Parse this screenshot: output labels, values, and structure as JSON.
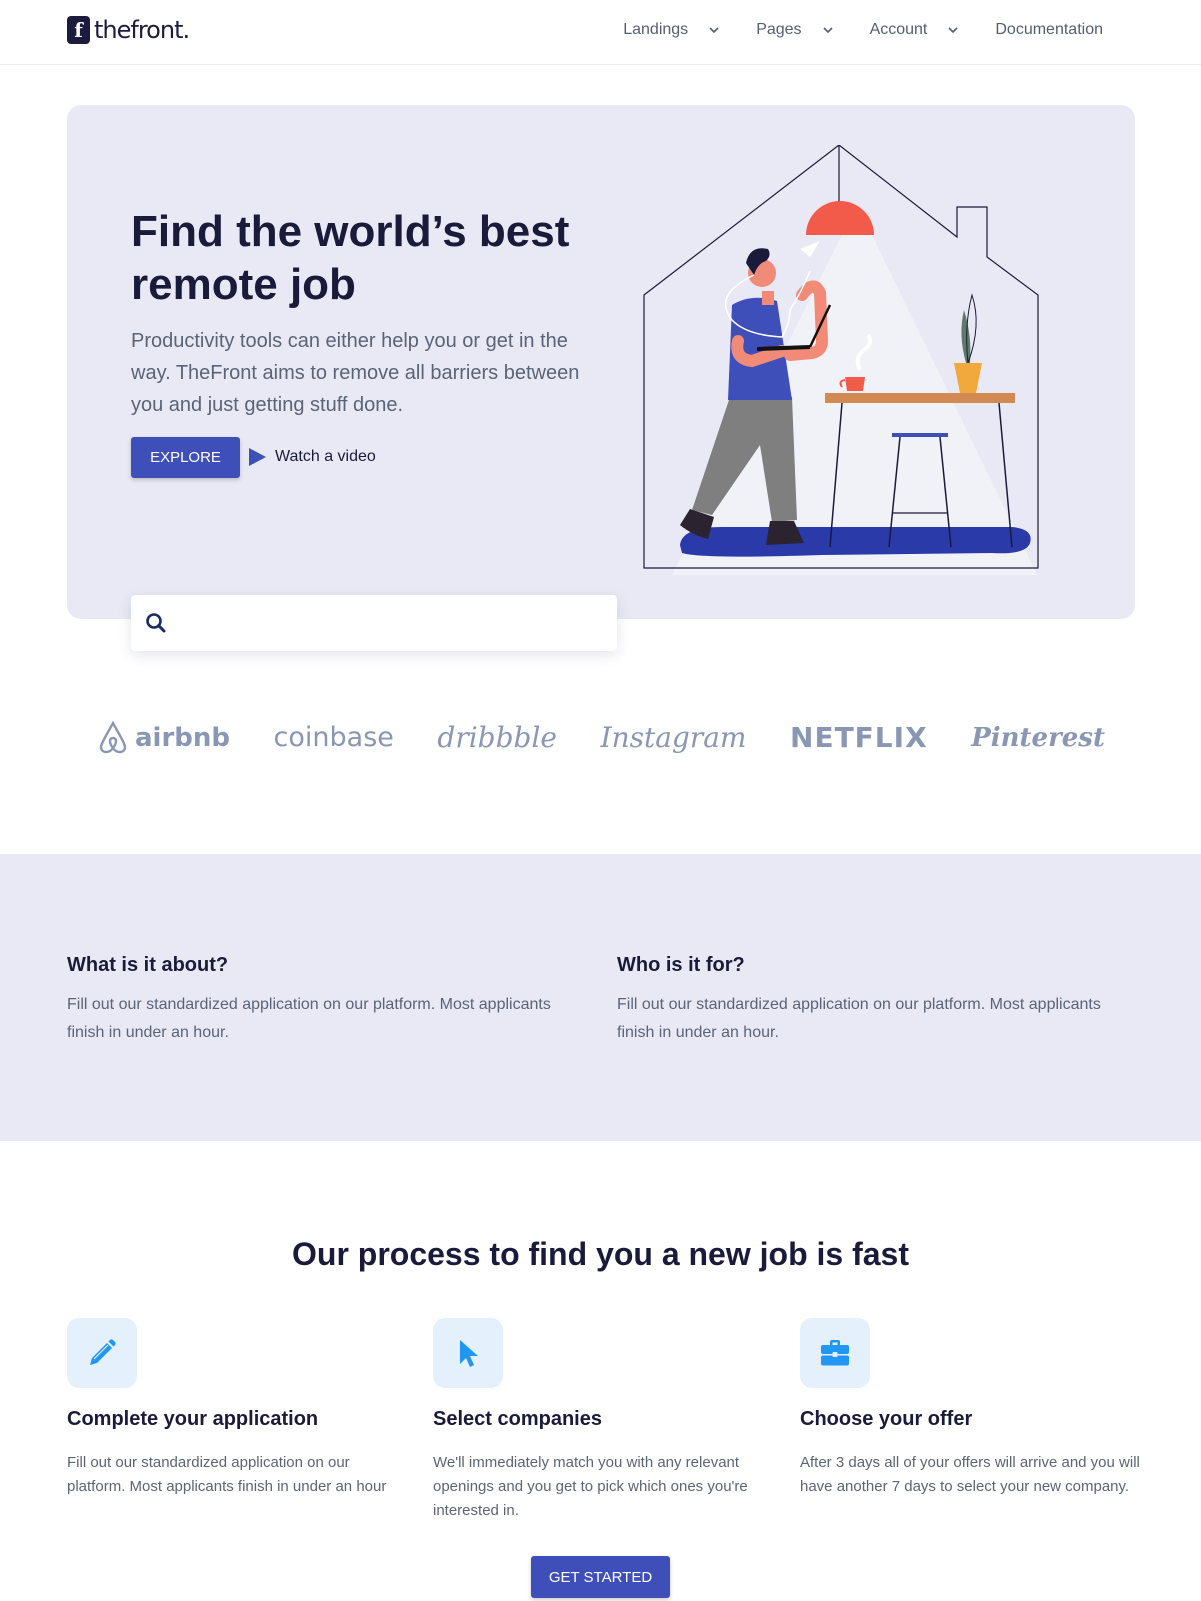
{
  "header": {
    "logo_mark": "f",
    "logo_text": "thefront.",
    "nav": [
      {
        "label": "Landings"
      },
      {
        "label": "Pages"
      },
      {
        "label": "Account"
      },
      {
        "label": "Documentation"
      }
    ]
  },
  "hero": {
    "title": "Find the world’s best remote job",
    "subtitle": "Productivity tools can either help you or get in the way. TheFront aims to remove all barriers between you and just getting stuff done.",
    "explore_label": "EXPLORE",
    "watch_label": "Watch a video",
    "search_placeholder": ""
  },
  "logos": [
    "airbnb",
    "coinbase",
    "dribbble",
    "Instagram",
    "NETFLIX",
    "Pinterest"
  ],
  "about": [
    {
      "title": "What is it about?",
      "text": "Fill out our standardized application on our platform. Most applicants finish in under an hour."
    },
    {
      "title": "Who is it for?",
      "text": "Fill out our standardized application on our platform. Most applicants finish in under an hour."
    }
  ],
  "process": {
    "title": "Our process to find you a new job is fast",
    "steps": [
      {
        "icon": "pencil-icon",
        "title": "Complete your application",
        "text": "Fill out our standardized application on our platform. Most applicants finish in under an hour"
      },
      {
        "icon": "cursor-icon",
        "title": "Select companies",
        "text": "We'll immediately match you with any relevant openings and you get to pick which ones you're interested in."
      },
      {
        "icon": "briefcase-icon",
        "title": "Choose your offer",
        "text": "After 3 days all of your offers will arrive and you will have another 7 days to select your new company."
      }
    ],
    "cta_label": "GET STARTED"
  },
  "colors": {
    "primary": "#3f4fba",
    "hero_bg": "#e8e9f4",
    "icon_blue": "#2196f3",
    "icon_bg": "#e4f1fd",
    "logo_gray": "#8a97b4"
  }
}
